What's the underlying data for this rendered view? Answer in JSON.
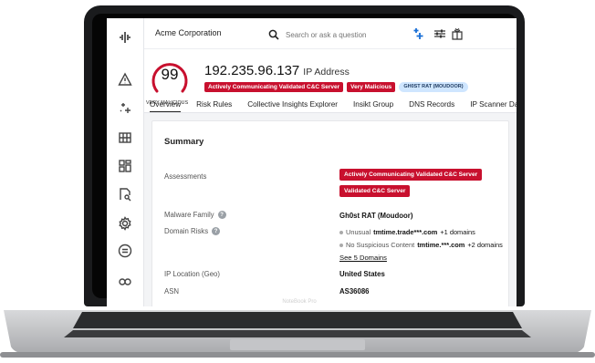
{
  "device": {
    "label": "NoteBook Pro"
  },
  "topbar": {
    "org": "Acme Corporation",
    "search_placeholder": "Search or ask a question"
  },
  "header": {
    "score": "99",
    "score_label": "VERY MALICIOUS",
    "ip": "192.235.96.137",
    "entity_type": "IP Address",
    "tags": [
      {
        "label": "Actively Communicating Validated C&C Server",
        "color": "#c8102e"
      },
      {
        "label": "Very Malicious",
        "color": "#c8102e"
      },
      {
        "label": "GH0ST RAT (MOUDOOR)",
        "color": "#cfe6ff"
      }
    ]
  },
  "tabs": [
    {
      "label": "Overview",
      "active": true
    },
    {
      "label": "Risk Rules"
    },
    {
      "label": "Collective Insights Explorer"
    },
    {
      "label": "Insikt Group"
    },
    {
      "label": "DNS Records"
    },
    {
      "label": "IP Scanner Data"
    }
  ],
  "summary": {
    "title": "Summary",
    "assessments_label": "Assessments",
    "assessments": [
      "Actively Communicating Validated C&C Server",
      "Validated C&C Server"
    ],
    "malware_label": "Malware Family",
    "malware": "Gh0st RAT (Moudoor)",
    "domain_label": "Domain Risks",
    "domains": [
      {
        "category": "Unusual",
        "domain": "tmtime.trade***.com",
        "extra": "+1 domains"
      },
      {
        "category": "No Suspicious Content",
        "domain": "tmtime.***.com",
        "extra": "+2 domains"
      }
    ],
    "see_domains": "See 5 Domains",
    "location_label": "IP Location (Geo)",
    "location": "United States",
    "asn_label": "ASN",
    "asn": "AS36086"
  },
  "colors": {
    "accent": "#c8102e",
    "nav_border": "#e4e6ea"
  }
}
